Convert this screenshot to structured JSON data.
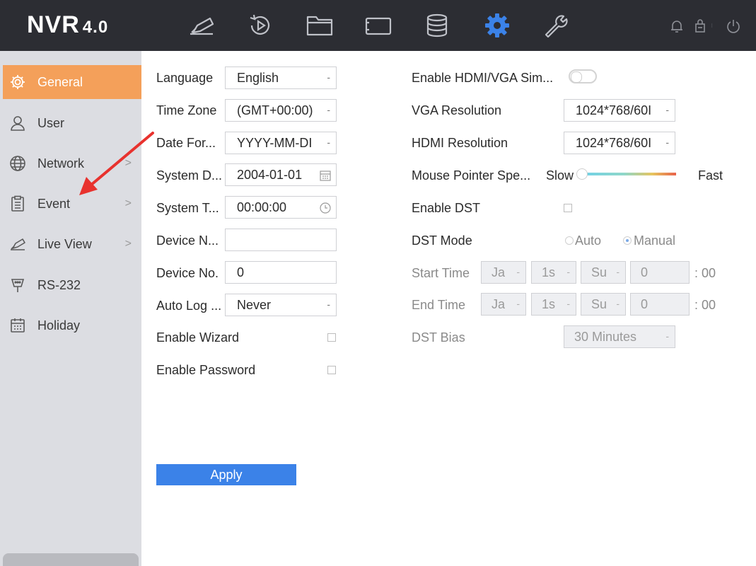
{
  "app": {
    "brand": "NVR",
    "version": "4.0"
  },
  "topnav": {
    "items": [
      {
        "name": "live-view",
        "icon": "camera-icon"
      },
      {
        "name": "playback",
        "icon": "playback-icon"
      },
      {
        "name": "file-management",
        "icon": "folder-icon"
      },
      {
        "name": "smart-analysis",
        "icon": "tablet-icon"
      },
      {
        "name": "storage",
        "icon": "database-icon"
      },
      {
        "name": "configuration",
        "icon": "gear-icon",
        "active": true
      },
      {
        "name": "maintenance",
        "icon": "wrench-icon"
      }
    ],
    "right_icons": [
      "bell-icon",
      "lock-icon",
      "power-icon"
    ]
  },
  "sidebar": {
    "items": [
      {
        "label": "General",
        "icon": "gear-icon",
        "active": true,
        "has_submenu": false
      },
      {
        "label": "User",
        "icon": "user-icon",
        "has_submenu": false
      },
      {
        "label": "Network",
        "icon": "globe-icon",
        "has_submenu": true
      },
      {
        "label": "Event",
        "icon": "clipboard-icon",
        "has_submenu": true
      },
      {
        "label": "Live View",
        "icon": "camera-icon",
        "has_submenu": true
      },
      {
        "label": "RS-232",
        "icon": "connector-icon",
        "has_submenu": false
      },
      {
        "label": "Holiday",
        "icon": "calendar-icon",
        "has_submenu": false
      }
    ],
    "chevron": ">"
  },
  "form_left": {
    "language": {
      "label": "Language",
      "value": "English"
    },
    "time_zone": {
      "label": "Time Zone",
      "value": "(GMT+00:00)"
    },
    "date_format": {
      "label": "Date For...",
      "value": "YYYY-MM-DI"
    },
    "system_date": {
      "label": "System D...",
      "value": "2004-01-01"
    },
    "system_time": {
      "label": "System T...",
      "value": "00:00:00"
    },
    "device_name": {
      "label": "Device N...",
      "value": ""
    },
    "device_no": {
      "label": "Device No.",
      "value": "0"
    },
    "auto_logout": {
      "label": "Auto Log ...",
      "value": "Never"
    },
    "enable_wizard": {
      "label": "Enable Wizard",
      "checked": false
    },
    "enable_password": {
      "label": "Enable Password",
      "checked": false
    }
  },
  "form_right": {
    "hdmi_vga_sim": {
      "label": "Enable HDMI/VGA Sim...",
      "enabled": false
    },
    "vga_resolution": {
      "label": "VGA Resolution",
      "value": "1024*768/60I"
    },
    "hdmi_resolution": {
      "label": "HDMI Resolution",
      "value": "1024*768/60I"
    },
    "mouse_speed": {
      "label": "Mouse Pointer Spe...",
      "min_label": "Slow",
      "max_label": "Fast",
      "level": 0
    },
    "enable_dst": {
      "label": "Enable DST",
      "checked": false
    },
    "dst_mode": {
      "label": "DST Mode",
      "options": [
        "Auto",
        "Manual"
      ],
      "selected": "Manual"
    },
    "start_time": {
      "label": "Start Time",
      "month": "Ja",
      "week": "1s",
      "day": "Su",
      "hour": "0",
      "suffix": ": 00"
    },
    "end_time": {
      "label": "End Time",
      "month": "Ja",
      "week": "1s",
      "day": "Su",
      "hour": "0",
      "suffix": ": 00"
    },
    "dst_bias": {
      "label": "DST Bias",
      "value": "30 Minutes"
    }
  },
  "dropdown_glyph": "-",
  "apply_label": "Apply",
  "colors": {
    "topbar": "#2c2d33",
    "sidebar": "#dcdde2",
    "active_item": "#f4a05a",
    "active_nav_icon": "#3b82e8",
    "apply_button": "#3b82e8",
    "annotation_arrow": "#e8322e"
  }
}
